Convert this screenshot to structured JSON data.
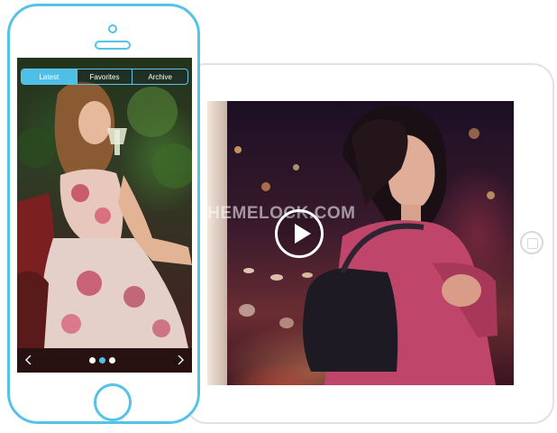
{
  "phone": {
    "tabs": [
      {
        "label": "Latest",
        "active": true
      },
      {
        "label": "Favorites",
        "active": false
      },
      {
        "label": "Archive",
        "active": false
      }
    ],
    "slider": {
      "dot_count": 3,
      "active_dot_index": 1,
      "prev_icon": "chevron-left-icon",
      "next_icon": "chevron-right-icon"
    }
  },
  "tablet": {
    "watermark": "THEMELOCK.COM",
    "play_icon": "play-icon"
  },
  "colors": {
    "accent": "#55c3e6",
    "device_frame_tablet": "#e2e2e2"
  }
}
